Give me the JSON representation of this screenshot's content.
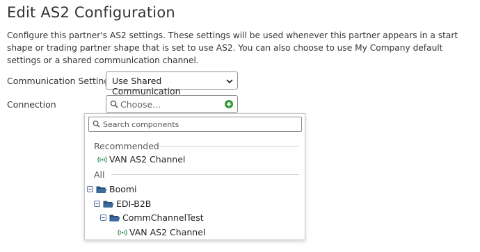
{
  "page": {
    "title": "Edit AS2 Configuration",
    "description": "Configure this partner's AS2 settings. These settings will be used whenever this partner appears in a start shape or trading partner shape that is set to use AS2. You can also choose to use My Company default settings or a shared communication channel."
  },
  "form": {
    "communication_label": "Communication Settings",
    "communication_value": "Use Shared Communication",
    "connection_label": "Connection",
    "connection_placeholder": "Choose..."
  },
  "dropdown": {
    "search_placeholder": "Search components",
    "recommended_label": "Recommended",
    "recommended_items": [
      {
        "label": "VAN AS2 Channel",
        "icon": "radio-signal-icon"
      }
    ],
    "all_label": "All",
    "tree": [
      {
        "label": "Boomi",
        "icon": "folder-open-icon"
      },
      {
        "label": "EDI-B2B",
        "icon": "folder-open-icon"
      },
      {
        "label": "CommChannelTest",
        "icon": "folder-open-icon"
      },
      {
        "label": "VAN AS2 Channel",
        "icon": "radio-signal-icon"
      }
    ]
  },
  "colors": {
    "add_button": "#3a9b3a",
    "channel_icon": "#2e8b57",
    "folder": "#2a4f7a",
    "collapse_toggle": "#5a6f9a"
  }
}
